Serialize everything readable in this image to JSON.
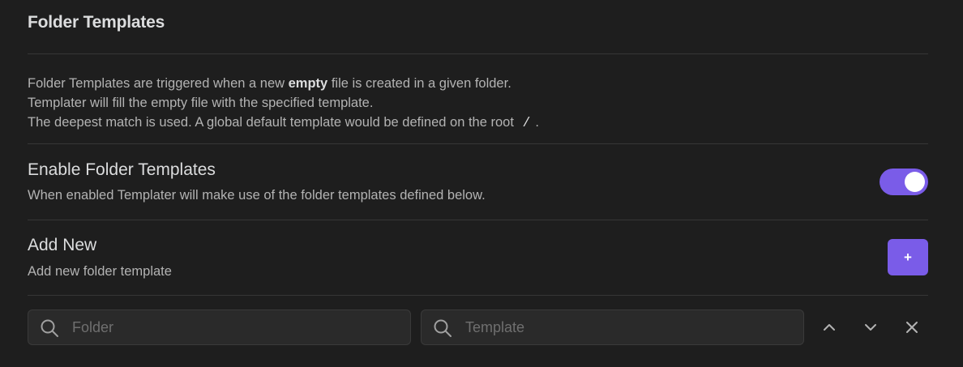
{
  "section": {
    "title": "Folder Templates",
    "description": {
      "line1_pre": "Folder Templates are triggered when a new ",
      "line1_bold": "empty",
      "line1_post": " file is created in a given folder.",
      "line2": "Templater will fill the empty file with the specified template.",
      "line3_pre": "The deepest match is used. A global default template would be defined on the root ",
      "line3_code": "/",
      "line3_post": "."
    }
  },
  "enable_setting": {
    "name": "Enable Folder Templates",
    "description": "When enabled Templater will make use of the folder templates defined below.",
    "enabled": true
  },
  "add_setting": {
    "name": "Add New",
    "description": "Add new folder template",
    "button_label": "+"
  },
  "template_row": {
    "folder_placeholder": "Folder",
    "folder_value": "",
    "template_placeholder": "Template",
    "template_value": "",
    "icons": [
      "search-icon",
      "chevron-up-icon",
      "chevron-down-icon",
      "close-icon"
    ]
  },
  "colors": {
    "accent": "#7a5ce8",
    "background": "#1e1e1e"
  }
}
